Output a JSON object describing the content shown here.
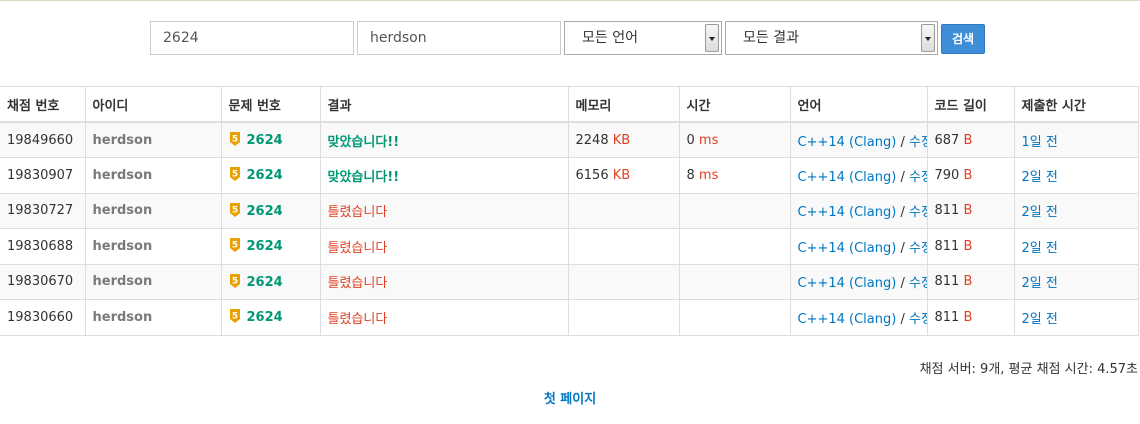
{
  "search": {
    "problem_value": "2624",
    "user_value": "herdson",
    "language_selected": "모든 언어",
    "result_selected": "모든 결과",
    "button_label": "검색"
  },
  "table": {
    "headers": [
      "채점 번호",
      "아이디",
      "문제 번호",
      "결과",
      "메모리",
      "시간",
      "언어",
      "코드 길이",
      "제출한 시간"
    ],
    "tier_color": "#e8a100",
    "tier_label": "5",
    "rows": [
      {
        "id": "19849660",
        "user": "herdson",
        "problem": "2624",
        "result": "맞았습니다!!",
        "result_type": "ac",
        "memory": "2248",
        "memory_unit": "KB",
        "time": "0",
        "time_unit": "ms",
        "lang": "C++14 (Clang)",
        "sep": " / ",
        "edit": "수정",
        "length": "687",
        "length_unit": "B",
        "submitted": "1일 전"
      },
      {
        "id": "19830907",
        "user": "herdson",
        "problem": "2624",
        "result": "맞았습니다!!",
        "result_type": "ac",
        "memory": "6156",
        "memory_unit": "KB",
        "time": "8",
        "time_unit": "ms",
        "lang": "C++14 (Clang)",
        "sep": " / ",
        "edit": "수정",
        "length": "790",
        "length_unit": "B",
        "submitted": "2일 전"
      },
      {
        "id": "19830727",
        "user": "herdson",
        "problem": "2624",
        "result": "틀렸습니다",
        "result_type": "wa",
        "memory": "",
        "memory_unit": "",
        "time": "",
        "time_unit": "",
        "lang": "C++14 (Clang)",
        "sep": " / ",
        "edit": "수정",
        "length": "811",
        "length_unit": "B",
        "submitted": "2일 전"
      },
      {
        "id": "19830688",
        "user": "herdson",
        "problem": "2624",
        "result": "틀렸습니다",
        "result_type": "wa",
        "memory": "",
        "memory_unit": "",
        "time": "",
        "time_unit": "",
        "lang": "C++14 (Clang)",
        "sep": " / ",
        "edit": "수정",
        "length": "811",
        "length_unit": "B",
        "submitted": "2일 전"
      },
      {
        "id": "19830670",
        "user": "herdson",
        "problem": "2624",
        "result": "틀렸습니다",
        "result_type": "wa",
        "memory": "",
        "memory_unit": "",
        "time": "",
        "time_unit": "",
        "lang": "C++14 (Clang)",
        "sep": " / ",
        "edit": "수정",
        "length": "811",
        "length_unit": "B",
        "submitted": "2일 전"
      },
      {
        "id": "19830660",
        "user": "herdson",
        "problem": "2624",
        "result": "틀렸습니다",
        "result_type": "wa",
        "memory": "",
        "memory_unit": "",
        "time": "",
        "time_unit": "",
        "lang": "C++14 (Clang)",
        "sep": " / ",
        "edit": "수정",
        "length": "811",
        "length_unit": "B",
        "submitted": "2일 전"
      }
    ]
  },
  "footer": {
    "server_info": "채점 서버: 9개, 평균 채점 시간: 4.57초",
    "first_page_link": "첫 페이지"
  },
  "colors": {
    "accepted": "#009874",
    "wrong": "#dd4124",
    "link": "#0076c0",
    "button": "#3d8ed6"
  }
}
